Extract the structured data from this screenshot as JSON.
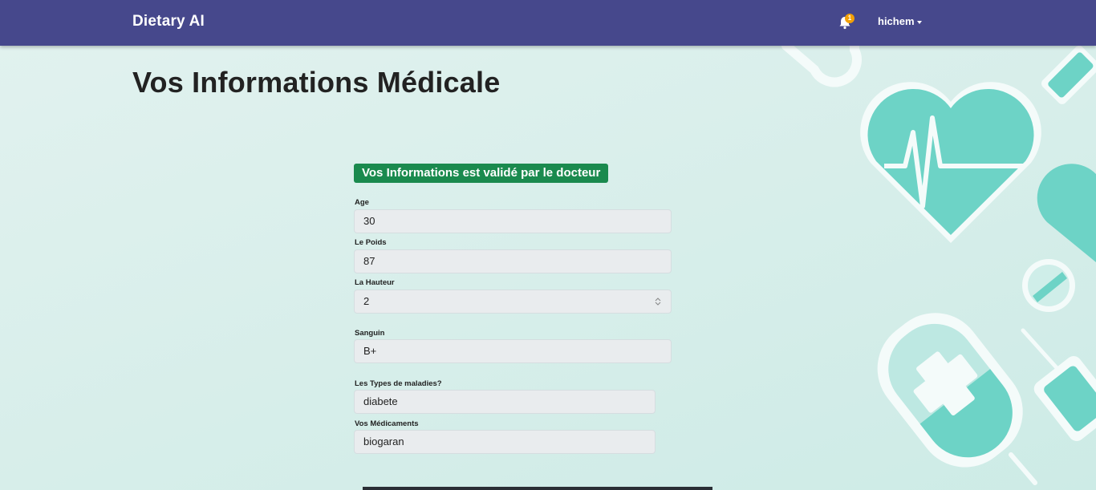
{
  "navbar": {
    "brand": "Dietary AI",
    "notification_count": "1",
    "username": "hichem"
  },
  "page": {
    "title": "Vos Informations Médicale"
  },
  "status": {
    "validated_label": "Vos Informations est validé par le docteur",
    "color": "#1a8a4e"
  },
  "form": {
    "age": {
      "label": "Age",
      "value": "30"
    },
    "weight": {
      "label": "Le Poids",
      "value": "87"
    },
    "height": {
      "label": "La Hauteur",
      "value": "2"
    },
    "blood": {
      "label": "Sanguin",
      "value": "B+"
    },
    "diseases": {
      "label": "Les Types de maladies?",
      "value": "diabete"
    },
    "medications": {
      "label": "Vos Médicaments",
      "value": "biogaran"
    }
  },
  "colors": {
    "navbar": "#46488c",
    "accent_teal": "#6dd3c6",
    "badge": "#f2a007"
  }
}
